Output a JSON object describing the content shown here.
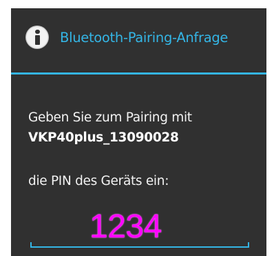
{
  "dialog": {
    "title": "Bluetooth-Pairing-Anfrage",
    "icon": "info-icon",
    "message_line1": "Geben Sie zum Pairing mit",
    "device_name": "VKP40plus_13090028",
    "message_line2": "die PIN des Geräts ein:",
    "pin_value": "1234",
    "accent_color": "#34b5e5",
    "pin_color": "#ff00ff",
    "background_color": "#303030"
  }
}
